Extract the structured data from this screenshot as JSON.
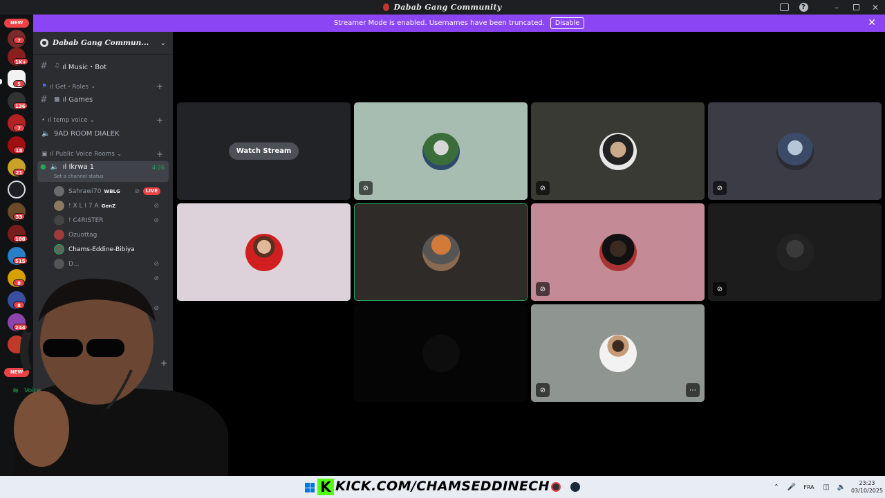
{
  "window": {
    "title": "Dabab Gang Community"
  },
  "banner": {
    "text": "Streamer Mode is enabled. Usernames have been truncated.",
    "disable_label": "Disable"
  },
  "rail": {
    "badges": [
      "7",
      "1K+",
      "5",
      "136",
      "7",
      "18",
      "21",
      "33",
      "188",
      "515",
      "8",
      "8",
      "244"
    ],
    "new_label": "NEW"
  },
  "server": {
    "name": "Dabab Gang Commun..."
  },
  "channels": {
    "music_bot": "ıl Music・Bot",
    "cat_roles": "ıl Get・Roles",
    "games": "ıl Games",
    "cat_temp_voice": "ıl temp voice",
    "room_dialek": "9AD ROOM DIALEK",
    "cat_public_voice": "ıl Public Voice Rooms",
    "active_vc": "ıl Ikrwa 1",
    "active_vc_timer": "4:26",
    "active_vc_status": "Set a channel status"
  },
  "members": [
    {
      "name": "Sahrawi70",
      "tag": "WBLG"
    },
    {
      "name": "! X L I 7 A",
      "tag": "GenZ"
    },
    {
      "name": "! C4RISTER",
      "tag": ""
    },
    {
      "name": "Ozuottag",
      "tag": ""
    },
    {
      "name": "Chams-Eddine-Bibiya",
      "tag": ""
    },
    {
      "name": "D...",
      "tag": ""
    }
  ],
  "live_label": "LIVE",
  "stage": {
    "watch_label": "Watch Stream"
  },
  "sidebar_bottom": {
    "voice_label": "Voice"
  },
  "taskbar": {
    "kick_url": "KICK.COM/CHAMSEDDINECH",
    "lang": "FRA",
    "time": "23:23",
    "date": "03/10/2025"
  },
  "colors": {
    "banner": "#8c45f2",
    "speaking": "#23a55a",
    "live": "#ed4245",
    "kick": "#53fc18"
  }
}
